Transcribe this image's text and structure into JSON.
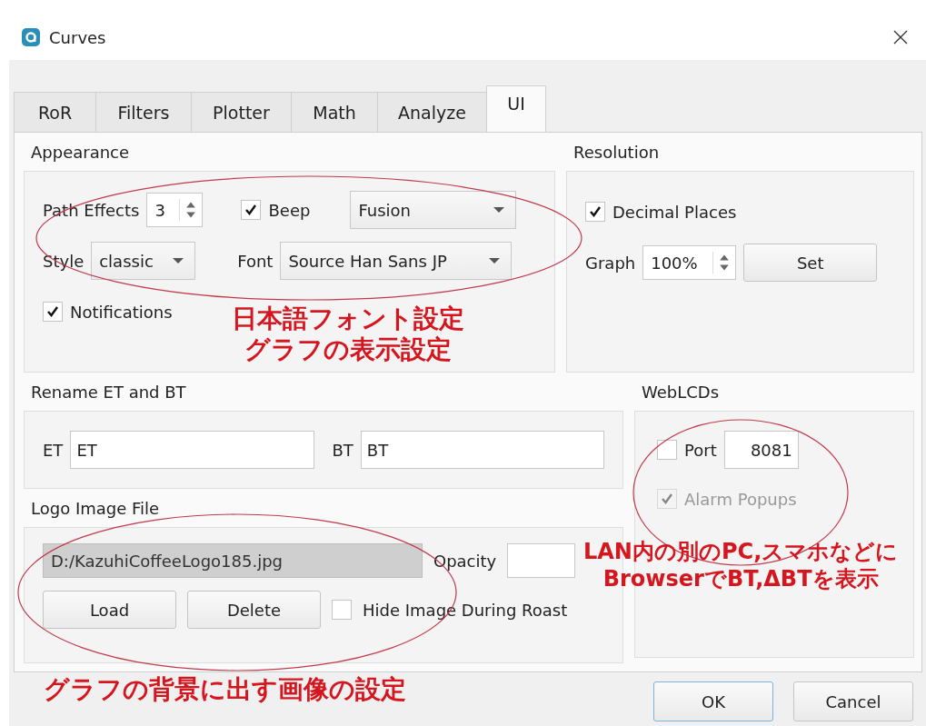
{
  "window": {
    "title": "Curves"
  },
  "tabs": [
    {
      "label": "RoR",
      "selected": false
    },
    {
      "label": "Filters",
      "selected": false
    },
    {
      "label": "Plotter",
      "selected": false
    },
    {
      "label": "Math",
      "selected": false
    },
    {
      "label": "Analyze",
      "selected": false
    },
    {
      "label": "UI",
      "selected": true
    }
  ],
  "appearance": {
    "title": "Appearance",
    "path_effects": {
      "label": "Path Effects",
      "value": "3"
    },
    "beep": {
      "label": "Beep",
      "checked": true
    },
    "theme": {
      "value": "Fusion"
    },
    "style": {
      "label": "Style",
      "value": "classic"
    },
    "font": {
      "label": "Font",
      "value": "Source Han Sans JP"
    },
    "notifications": {
      "label": "Notifications",
      "checked": true
    }
  },
  "resolution": {
    "title": "Resolution",
    "decimal_places": {
      "label": "Decimal Places",
      "checked": true
    },
    "graph": {
      "label": "Graph",
      "value": "100%"
    },
    "set_button": "Set"
  },
  "rename": {
    "title": "Rename ET and BT",
    "fields": [
      {
        "label": "ET",
        "value": "ET"
      },
      {
        "label": "BT",
        "value": "BT"
      }
    ]
  },
  "logo": {
    "title": "Logo Image File",
    "path": "D:/KazuhiCoffeeLogo185.jpg",
    "opacity_label": "Opacity",
    "buttons": [
      "Load",
      "Delete"
    ],
    "hide": {
      "label": "Hide Image During Roast",
      "checked": false
    }
  },
  "weblcds": {
    "title": "WebLCDs",
    "port": {
      "label": "Port",
      "checked": false,
      "value": "8081"
    },
    "alarm": {
      "label": "Alarm Popups",
      "checked": true,
      "disabled": true
    }
  },
  "buttons": [
    {
      "label": "OK",
      "default": true
    },
    {
      "label": "Cancel",
      "default": false
    }
  ],
  "annotations": [
    {
      "lines": [
        "日本語フォント設定",
        "グラフの表示設定"
      ]
    },
    {
      "lines": [
        "LAN内の別のPC,スマホなどに",
        "BrowserでBT,ΔBTを表示"
      ]
    },
    {
      "lines": [
        "グラフの背景に出す画像の設定"
      ]
    }
  ]
}
